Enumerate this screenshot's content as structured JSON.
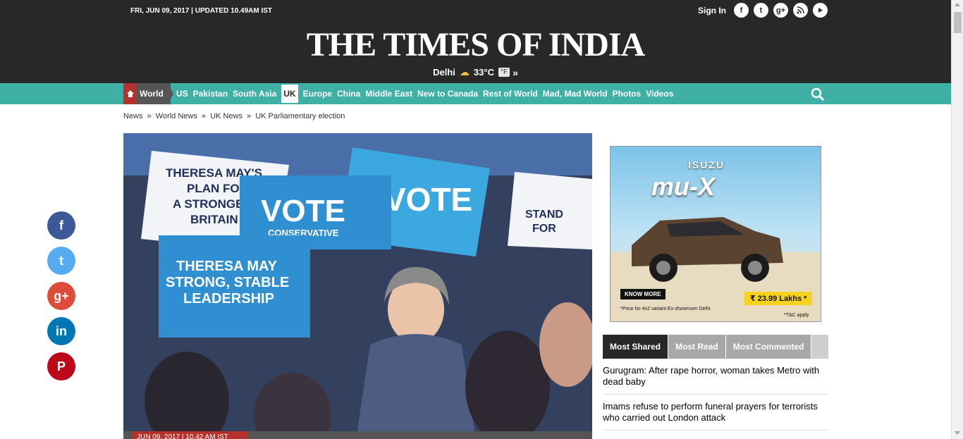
{
  "header": {
    "dateline": "FRI, JUN 09, 2017 | UPDATED 10.49AM IST",
    "signin_label": "Sign In",
    "social_icons": [
      "facebook-icon",
      "twitter-icon",
      "google-plus-icon",
      "rss-icon",
      "youtube-icon"
    ],
    "logo_text": "THE TIMES OF INDIA",
    "weather": {
      "city": "Delhi",
      "icon": "partly-cloudy-icon",
      "temperature": "33°C",
      "unit_toggle": "°F",
      "more": "»"
    }
  },
  "nav": {
    "home_icon": "home-icon",
    "section": "World",
    "items": [
      "US",
      "Pakistan",
      "South Asia",
      "UK",
      "Europe",
      "China",
      "Middle East",
      "New to Canada",
      "Rest of World",
      "Mad, Mad World",
      "Photos",
      "Videos"
    ],
    "active_item": "UK",
    "search_icon": "search-icon"
  },
  "breadcrumb": [
    "News",
    "»",
    "World News",
    "»",
    "UK News",
    "»",
    "UK Parliamentary election"
  ],
  "hero": {
    "signs": [
      "THERESA MAY'S PLAN FOR A STRONGER BRITAIN",
      "VOTE CONSERVATIVE",
      "VOTE CONSERVATIVE",
      "THERESA MAY STRONG, STABLE LEADERSHIP",
      "STAND FOR"
    ],
    "caption": "JUN 09, 2017 | 10.42 AM IST"
  },
  "share_rail": [
    {
      "icon": "facebook-icon",
      "glyph": "f",
      "color": "#3b5998"
    },
    {
      "icon": "twitter-icon",
      "glyph": "t",
      "color": "#55acee"
    },
    {
      "icon": "google-plus-icon",
      "glyph": "g+",
      "color": "#dd4b39"
    },
    {
      "icon": "linkedin-icon",
      "glyph": "in",
      "color": "#0077b5"
    },
    {
      "icon": "pinterest-icon",
      "glyph": "P",
      "color": "#bd081c"
    }
  ],
  "ad": {
    "brand": "ISUZU",
    "model": "mu-X",
    "cta": "KNOW MORE",
    "price": "₹ 23.99 Lakhs *",
    "note": "*Price for 4x2 variant Ex-showroom Delhi",
    "tc": "*T&C apply"
  },
  "tabs": [
    "Most Shared",
    "Most Read",
    "Most Commented"
  ],
  "stories": [
    "Gurugram: After rape horror, woman takes Metro with dead baby",
    "Imams refuse to perform funeral prayers for terrorists who carried out London attack"
  ]
}
